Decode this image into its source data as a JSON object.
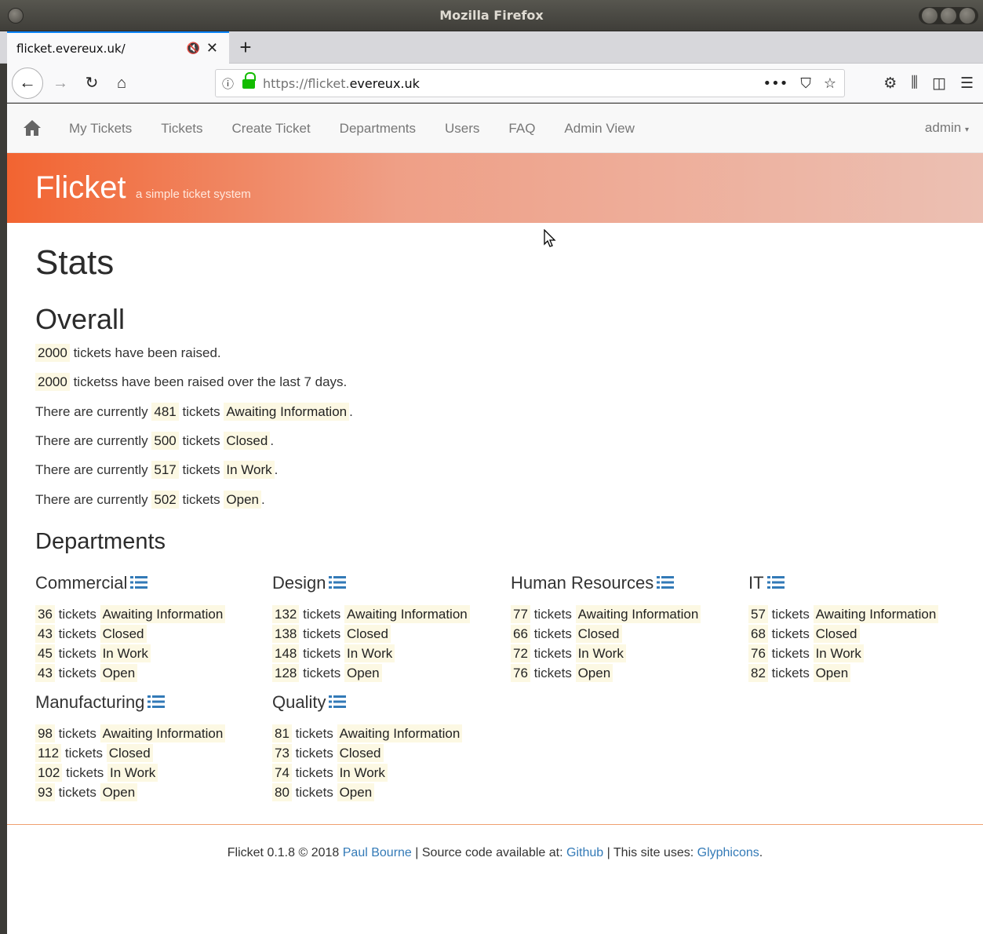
{
  "window": {
    "title": "Mozilla Firefox"
  },
  "tab": {
    "title": "flicket.evereux.uk/"
  },
  "urlbar": {
    "prefix": "https://flicket.",
    "domain": "evereux.uk"
  },
  "site_nav": {
    "links": [
      "My Tickets",
      "Tickets",
      "Create Ticket",
      "Departments",
      "Users",
      "FAQ",
      "Admin View"
    ],
    "user": "admin"
  },
  "banner": {
    "brand": "Flicket",
    "tagline": "a simple ticket system"
  },
  "page": {
    "title": "Stats",
    "overall_heading": "Overall",
    "raised_total": "2000",
    "raised_total_text": "tickets have been raised.",
    "raised_week": "2000",
    "raised_week_text": "ticketss have been raised over the last 7 days.",
    "status_prefix": "There are currently",
    "status_word": "tickets",
    "statuses": [
      {
        "count": "481",
        "label": "Awaiting Information"
      },
      {
        "count": "500",
        "label": "Closed"
      },
      {
        "count": "517",
        "label": "In Work"
      },
      {
        "count": "502",
        "label": "Open"
      }
    ],
    "departments_heading": "Departments",
    "departments": [
      {
        "name": "Commercial",
        "rows": [
          {
            "count": "36",
            "label": "Awaiting Information"
          },
          {
            "count": "43",
            "label": "Closed"
          },
          {
            "count": "45",
            "label": "In Work"
          },
          {
            "count": "43",
            "label": "Open"
          }
        ]
      },
      {
        "name": "Design",
        "rows": [
          {
            "count": "132",
            "label": "Awaiting Information"
          },
          {
            "count": "138",
            "label": "Closed"
          },
          {
            "count": "148",
            "label": "In Work"
          },
          {
            "count": "128",
            "label": "Open"
          }
        ]
      },
      {
        "name": "Human Resources",
        "rows": [
          {
            "count": "77",
            "label": "Awaiting Information"
          },
          {
            "count": "66",
            "label": "Closed"
          },
          {
            "count": "72",
            "label": "In Work"
          },
          {
            "count": "76",
            "label": "Open"
          }
        ]
      },
      {
        "name": "IT",
        "rows": [
          {
            "count": "57",
            "label": "Awaiting Information"
          },
          {
            "count": "68",
            "label": "Closed"
          },
          {
            "count": "76",
            "label": "In Work"
          },
          {
            "count": "82",
            "label": "Open"
          }
        ]
      },
      {
        "name": "Manufacturing",
        "rows": [
          {
            "count": "98",
            "label": "Awaiting Information"
          },
          {
            "count": "112",
            "label": "Closed"
          },
          {
            "count": "102",
            "label": "In Work"
          },
          {
            "count": "93",
            "label": "Open"
          }
        ]
      },
      {
        "name": "Quality",
        "rows": [
          {
            "count": "81",
            "label": "Awaiting Information"
          },
          {
            "count": "73",
            "label": "Closed"
          },
          {
            "count": "74",
            "label": "In Work"
          },
          {
            "count": "80",
            "label": "Open"
          }
        ]
      }
    ]
  },
  "footer": {
    "prefix": "Flicket 0.1.8 © 2018",
    "author": "Paul Bourne",
    "source_text": "| Source code available at:",
    "github": "Github",
    "uses_text": "| This site uses:",
    "glyphicons": "Glyphicons",
    "suffix": "."
  },
  "colors": {
    "accent": "#f26431",
    "highlight": "#fcf8e3",
    "link": "#337ab7"
  }
}
